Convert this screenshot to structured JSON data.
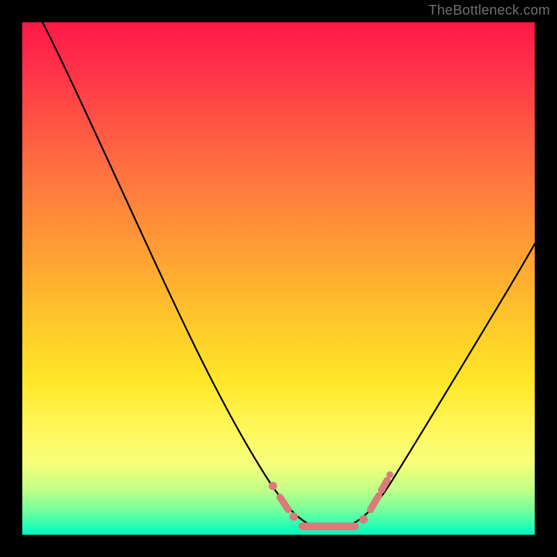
{
  "watermark": "TheBottleneck.com",
  "chart_data": {
    "type": "line",
    "title": "",
    "xlabel": "",
    "ylabel": "",
    "xlim": [
      0,
      100
    ],
    "ylim": [
      0,
      100
    ],
    "grid": false,
    "legend": false,
    "series": [
      {
        "name": "bottleneck-curve",
        "color": "#000000",
        "x": [
          4,
          10,
          16,
          22,
          28,
          34,
          40,
          45,
          50,
          53,
          55,
          57,
          59,
          61,
          63,
          65,
          69,
          74,
          80,
          86,
          92,
          98,
          100
        ],
        "y": [
          100,
          88,
          76,
          64,
          52,
          40,
          28,
          18,
          10,
          5,
          3,
          2,
          1.5,
          1.5,
          2,
          3,
          8,
          18,
          30,
          42,
          54,
          65,
          69
        ]
      },
      {
        "name": "highlight-band",
        "color": "#db7a7a",
        "x": [
          50,
          53,
          55,
          57,
          59,
          61,
          63,
          65,
          67
        ],
        "y": [
          10,
          5,
          3,
          2,
          1.5,
          1.5,
          2,
          3,
          6
        ]
      }
    ],
    "colors": {
      "gradient_top": "#ff1846",
      "gradient_mid": "#ffe728",
      "gradient_bottom": "#00f5c0",
      "curve": "#000000",
      "highlight": "#db7a7a",
      "frame": "#000000"
    }
  }
}
